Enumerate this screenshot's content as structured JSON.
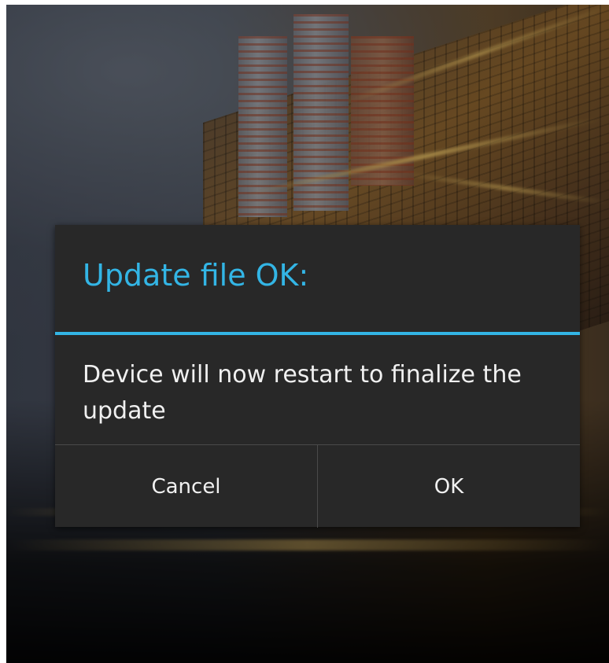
{
  "dialog": {
    "title": "Update file OK:",
    "message": "Device will now restart to finalize the update",
    "buttons": {
      "cancel": "Cancel",
      "ok": "OK"
    }
  },
  "colors": {
    "accent": "#33b5e5",
    "dialog_background": "#282828",
    "text": "#f0f0f0"
  }
}
